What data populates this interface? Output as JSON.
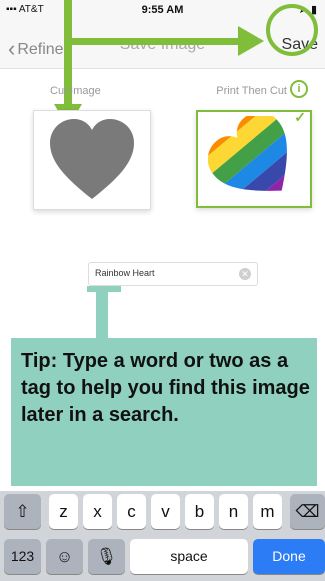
{
  "status_bar": {
    "carrier": "AT&T",
    "time": "9:55 AM"
  },
  "nav": {
    "back_label": "Refine",
    "title": "Save Image",
    "save_label": "Save"
  },
  "options": {
    "cut_image_label": "Cut Image",
    "print_then_cut_label": "Print Then Cut",
    "selected": "Print Then Cut"
  },
  "name_field": {
    "value": "Rainbow Heart"
  },
  "tip": {
    "text": "Tip: Type a word or two as a tag to help you find this image later in a search."
  },
  "keyboard": {
    "row3": [
      "z",
      "x",
      "c",
      "v",
      "b",
      "n",
      "m"
    ],
    "numbers_label": "123",
    "space_label": "space",
    "done_label": "Done"
  },
  "colors": {
    "accent_green": "#7fbd3a",
    "callout_teal": "#8fd1be",
    "done_blue": "#2c7cf6"
  }
}
